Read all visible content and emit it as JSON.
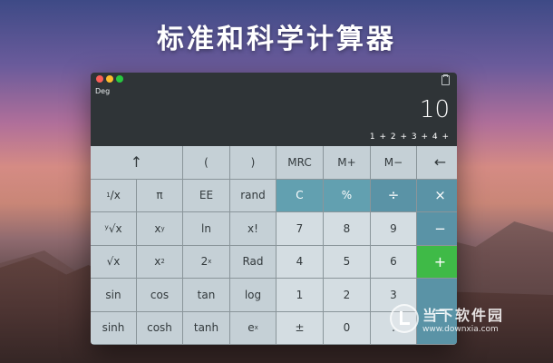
{
  "headline": "标准和科学计算器",
  "window": {
    "mode": "Deg",
    "result": "10",
    "expression": "1 + 2 + 3 + 4 +"
  },
  "keys": {
    "up": "↑",
    "lparen": "(",
    "rparen": ")",
    "mrc": "MRC",
    "mplus": "M+",
    "mminus": "M−",
    "back": "←",
    "recip_num": "1",
    "recip_den": "/x",
    "pi": "π",
    "ee": "EE",
    "rand": "rand",
    "clear": "C",
    "percent": "%",
    "divide": "÷",
    "multiply": "×",
    "ysqrtx": "ʸ√x",
    "xy_base": "x",
    "xy_exp": "y",
    "ln": "ln",
    "fact": "x!",
    "n7": "7",
    "n8": "8",
    "n9": "9",
    "minus": "−",
    "sqrt": "√x",
    "x2_base": "x",
    "x2_exp": "2",
    "twox_base": "2",
    "twox_exp": "x",
    "rad": "Rad",
    "n4": "4",
    "n5": "5",
    "n6": "6",
    "plus": "+",
    "sin": "sin",
    "cos": "cos",
    "tan": "tan",
    "log": "log",
    "n1": "1",
    "n2": "2",
    "n3": "3",
    "equals": "=",
    "sinh": "sinh",
    "cosh": "cosh",
    "tanh": "tanh",
    "ex_base": "e",
    "ex_exp": "x",
    "plusminus": "±",
    "n0": "0",
    "dot": "."
  },
  "watermark": {
    "main": "当下软件园",
    "url": "www.downxia.com"
  },
  "icons": [
    "close-light-icon",
    "minimize-light-icon",
    "zoom-light-icon",
    "clipboard-icon"
  ]
}
